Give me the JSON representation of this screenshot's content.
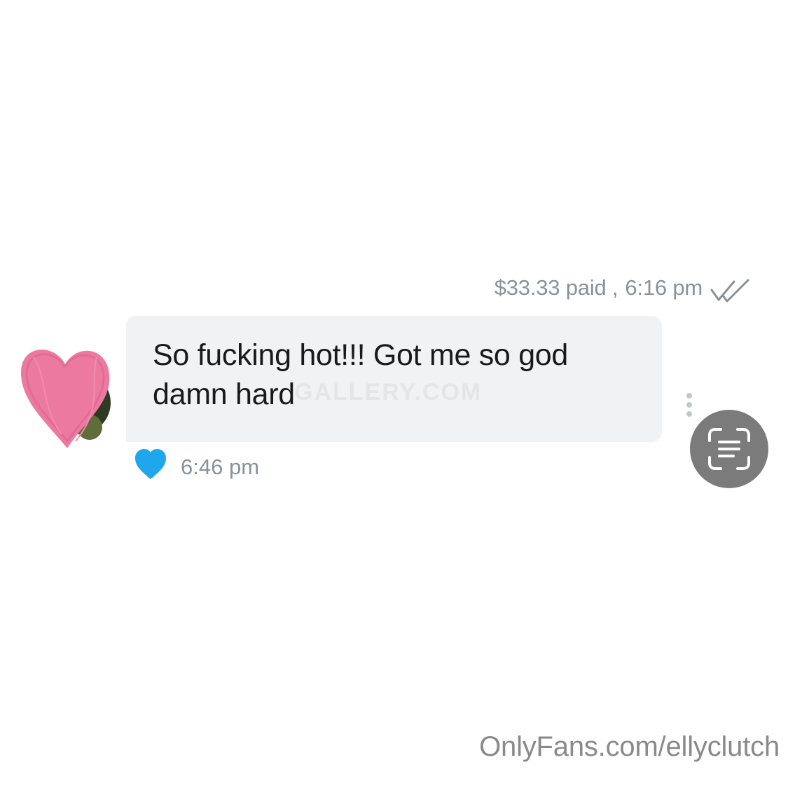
{
  "message": {
    "meta_paid": "$33.33 paid ,",
    "meta_time": "6:16 pm",
    "text": "So fucking hot!!! Got me so god damn hard",
    "inline_watermark": "GALLERY.COM",
    "reply_time": "6:46 pm"
  },
  "footer": {
    "watermark": "OnlyFans.com/ellyclutch"
  },
  "colors": {
    "bubble": "#f0f2f3",
    "meta_text": "#8a9199",
    "like_heart": "#1ea7ec",
    "avatar_scribble": "#ec7aa0",
    "scan_button": "#7b7b7b"
  },
  "icons": {
    "read_receipt": "double-check-icon",
    "like": "heart-icon",
    "more": "vertical-dots-icon",
    "scan": "scan-text-icon"
  }
}
